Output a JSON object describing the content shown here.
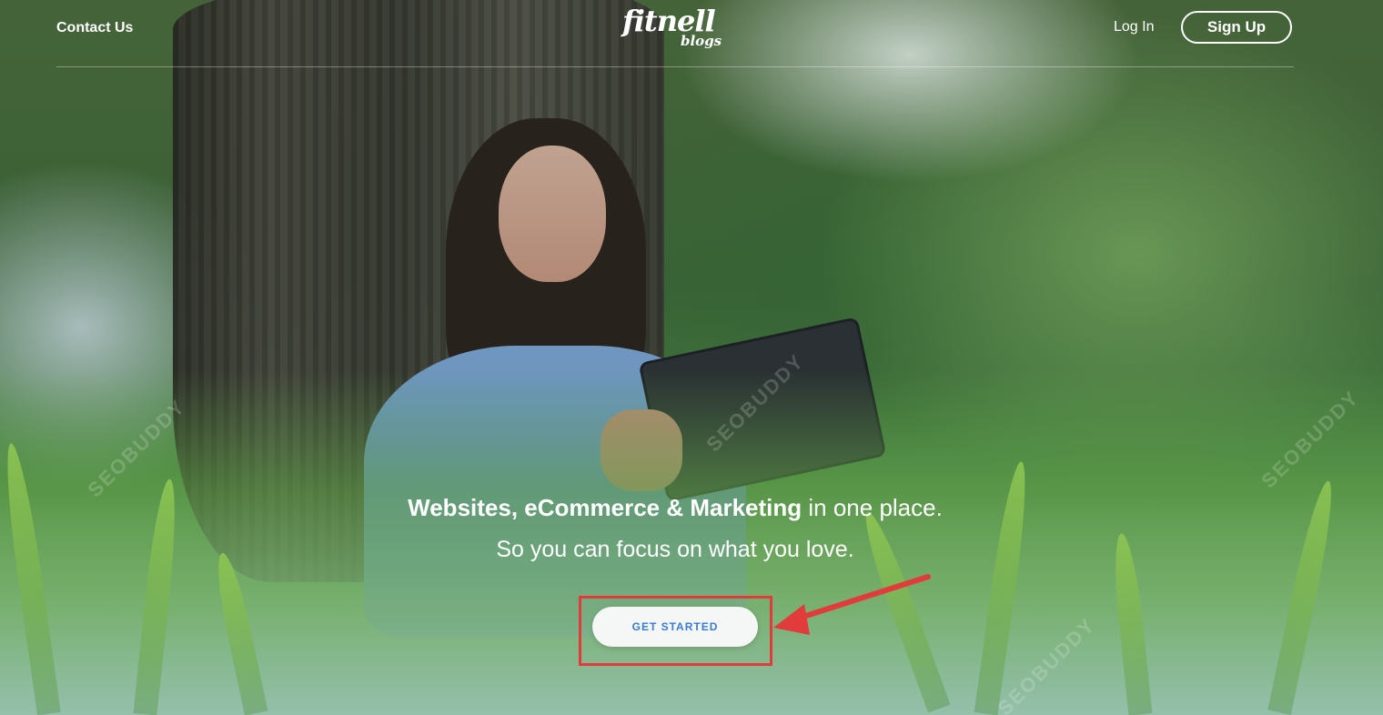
{
  "header": {
    "contact_label": "Contact Us",
    "logo_main": "fitnell",
    "logo_sub": "blogs",
    "login_label": "Log In",
    "signup_label": "Sign Up"
  },
  "hero": {
    "headline_strong": "Websites, eCommerce & Marketing",
    "headline_rest": " in one place.",
    "subheadline": "So you can focus on what you love.",
    "cta_label": "GET STARTED"
  },
  "watermark_text": "SEOBUDDY",
  "colors": {
    "cta_text": "#3a7bd5",
    "highlight": "#e23b3b",
    "nav_text": "#ffffff"
  }
}
